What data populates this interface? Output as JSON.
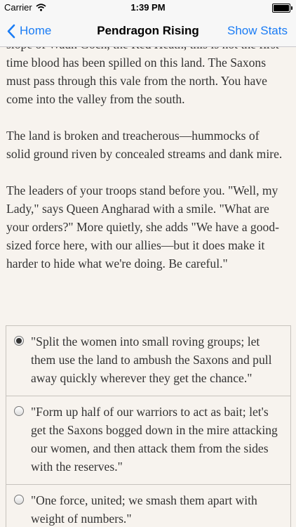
{
  "status_bar": {
    "carrier": "Carrier",
    "time": "1:39 PM"
  },
  "nav": {
    "back_label": "Home",
    "title": "Pendragon Rising",
    "stats_label": "Show Stats"
  },
  "story": {
    "paragraphs": [
      "slope of Waun Goch, the Red Heath, this is not the first time blood has been spilled on this land. The Saxons must pass through this vale from the north. You have come into the valley from the south.",
      "The land is broken and treacherous—hummocks of solid ground riven by concealed streams and dank mire.",
      "The leaders of your troops stand before you. \"Well, my Lady,\" says Queen Angharad with a smile. \"What are your orders?\" More quietly, she adds \"We have a good-sized force here, with our allies—but it does make it harder to hide what we're doing. Be careful.\""
    ]
  },
  "choices": [
    {
      "text": "\"Split the women into small roving groups; let them use the land to ambush the Saxons and pull away quickly wherever they get the chance.\"",
      "selected": true
    },
    {
      "text": "\"Form up half of our warriors to act as bait; let's get the Saxons bogged down in the mire attacking our women, and then attack them from the sides with the reserves.\"",
      "selected": false
    },
    {
      "text": "\"One force, united; we smash them apart with weight of numbers.\"",
      "selected": false
    }
  ],
  "colors": {
    "accent": "#1a7cf5",
    "background": "#f7f3ee",
    "text": "#333333"
  },
  "icons": {
    "wifi": "wifi-icon",
    "battery": "battery-icon",
    "back": "chevron-left-icon"
  }
}
